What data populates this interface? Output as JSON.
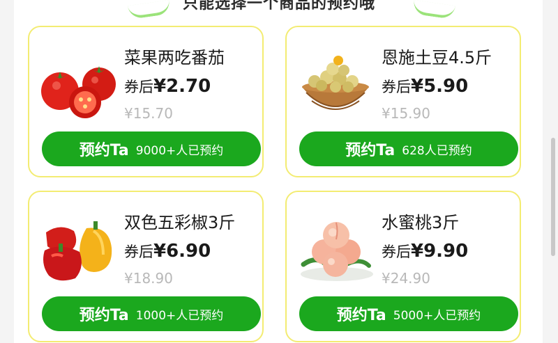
{
  "header": {
    "title": "只能选择一个商品的预约哦"
  },
  "products": [
    {
      "name": "菜果两吃番茄",
      "coupon_prefix": "券后",
      "price": "¥2.70",
      "original_price": "¥15.70",
      "button_label": "预约Ta",
      "booked_count": "9000+人已预约",
      "image_icon": "tomato-image"
    },
    {
      "name": "恩施土豆4.5斤",
      "coupon_prefix": "券后",
      "price": "¥5.90",
      "original_price": "¥15.90",
      "button_label": "预约Ta",
      "booked_count": "628人已预约",
      "image_icon": "potato-basket-image"
    },
    {
      "name": "双色五彩椒3斤",
      "coupon_prefix": "券后",
      "price": "¥6.90",
      "original_price": "¥18.90",
      "button_label": "预约Ta",
      "booked_count": "1000+人已预约",
      "image_icon": "bell-pepper-image"
    },
    {
      "name": "水蜜桃3斤",
      "coupon_prefix": "券后",
      "price": "¥9.90",
      "original_price": "¥24.90",
      "button_label": "预约Ta",
      "booked_count": "5000+人已预约",
      "image_icon": "peach-image"
    }
  ],
  "colors": {
    "accent_green": "#1ba81e",
    "card_border": "#f3ec72",
    "muted_price": "#b8b8b8"
  }
}
